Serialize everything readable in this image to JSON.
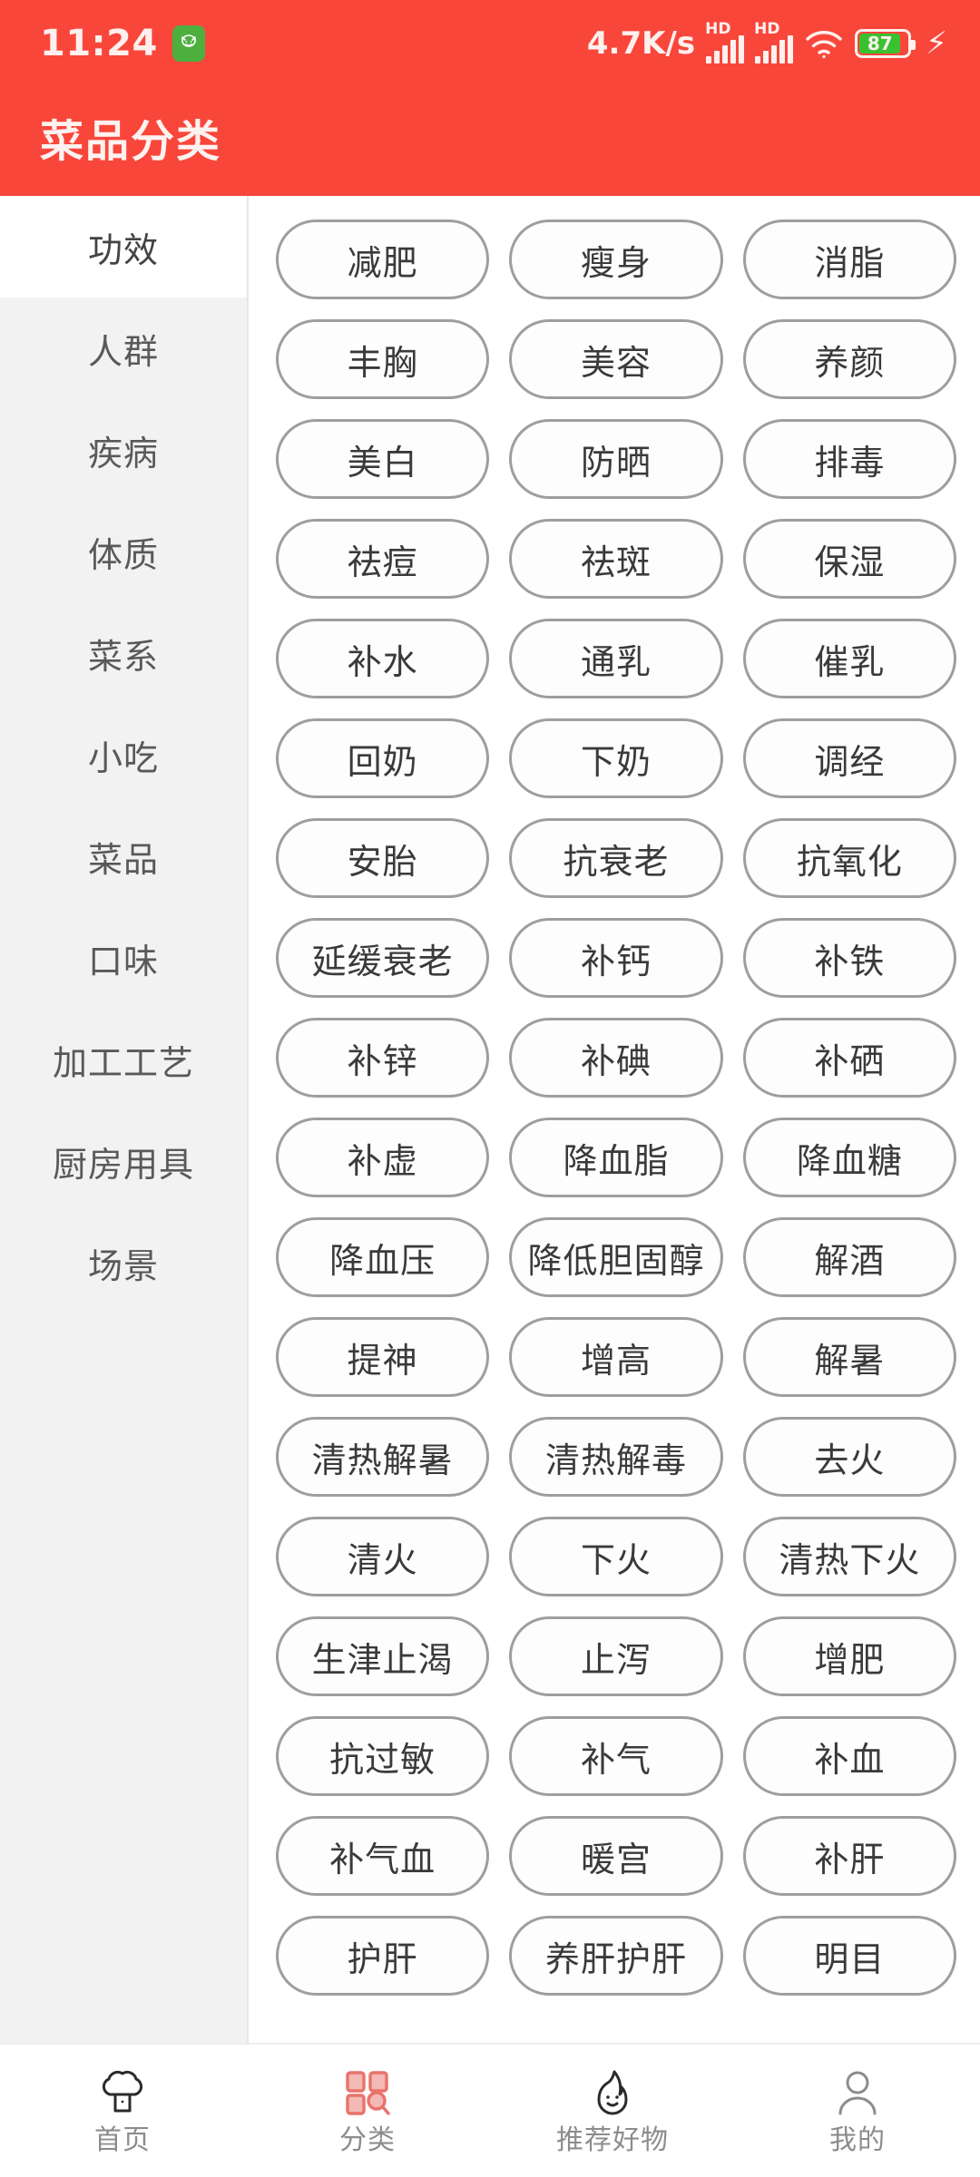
{
  "status_bar": {
    "time": "11:24",
    "badge_icon": "cat-face-icon",
    "network_speed": "4.7K/s",
    "sim1_label": "HD",
    "sim2_label": "HD",
    "wifi_icon": "wifi-icon",
    "battery_percent": "87",
    "battery_level": 87,
    "charging_icon": "lightning-bolt-icon"
  },
  "app_bar": {
    "title": "菜品分类"
  },
  "sidebar": {
    "active_index": 0,
    "items": [
      {
        "label": "功效"
      },
      {
        "label": "人群"
      },
      {
        "label": "疾病"
      },
      {
        "label": "体质"
      },
      {
        "label": "菜系"
      },
      {
        "label": "小吃"
      },
      {
        "label": "菜品"
      },
      {
        "label": "口味"
      },
      {
        "label": "加工工艺"
      },
      {
        "label": "厨房用具"
      },
      {
        "label": "场景"
      }
    ]
  },
  "tags": [
    {
      "label": "减肥"
    },
    {
      "label": "瘦身"
    },
    {
      "label": "消脂"
    },
    {
      "label": "丰胸"
    },
    {
      "label": "美容"
    },
    {
      "label": "养颜"
    },
    {
      "label": "美白"
    },
    {
      "label": "防晒"
    },
    {
      "label": "排毒"
    },
    {
      "label": "祛痘"
    },
    {
      "label": "祛斑"
    },
    {
      "label": "保湿"
    },
    {
      "label": "补水"
    },
    {
      "label": "通乳"
    },
    {
      "label": "催乳"
    },
    {
      "label": "回奶"
    },
    {
      "label": "下奶"
    },
    {
      "label": "调经"
    },
    {
      "label": "安胎"
    },
    {
      "label": "抗衰老"
    },
    {
      "label": "抗氧化"
    },
    {
      "label": "延缓衰老"
    },
    {
      "label": "补钙"
    },
    {
      "label": "补铁"
    },
    {
      "label": "补锌"
    },
    {
      "label": "补碘"
    },
    {
      "label": "补硒"
    },
    {
      "label": "补虚"
    },
    {
      "label": "降血脂"
    },
    {
      "label": "降血糖"
    },
    {
      "label": "降血压"
    },
    {
      "label": "降低胆固醇"
    },
    {
      "label": "解酒"
    },
    {
      "label": "提神"
    },
    {
      "label": "增高"
    },
    {
      "label": "解暑"
    },
    {
      "label": "清热解暑"
    },
    {
      "label": "清热解毒"
    },
    {
      "label": "去火"
    },
    {
      "label": "清火"
    },
    {
      "label": "下火"
    },
    {
      "label": "清热下火"
    },
    {
      "label": "生津止渴"
    },
    {
      "label": "止泻"
    },
    {
      "label": "增肥"
    },
    {
      "label": "抗过敏"
    },
    {
      "label": "补气"
    },
    {
      "label": "补血"
    },
    {
      "label": "补气血"
    },
    {
      "label": "暖宫"
    },
    {
      "label": "补肝"
    },
    {
      "label": "护肝"
    },
    {
      "label": "养肝护肝"
    },
    {
      "label": "明目"
    }
  ],
  "bottom_nav": {
    "active_index": 1,
    "items": [
      {
        "label": "首页",
        "icon": "chef-hat-icon"
      },
      {
        "label": "分类",
        "icon": "grid-search-icon"
      },
      {
        "label": "推荐好物",
        "icon": "flame-face-icon"
      },
      {
        "label": "我的",
        "icon": "person-icon"
      }
    ]
  },
  "colors": {
    "brand_red": "#F9463B",
    "accent_coral": "#E8736B",
    "tag_border": "#9E9E9E",
    "sidebar_bg": "#F2F2F2",
    "text_primary": "#3A3A3C",
    "text_muted": "#8C8C8C",
    "battery_green": "#39C12F"
  }
}
